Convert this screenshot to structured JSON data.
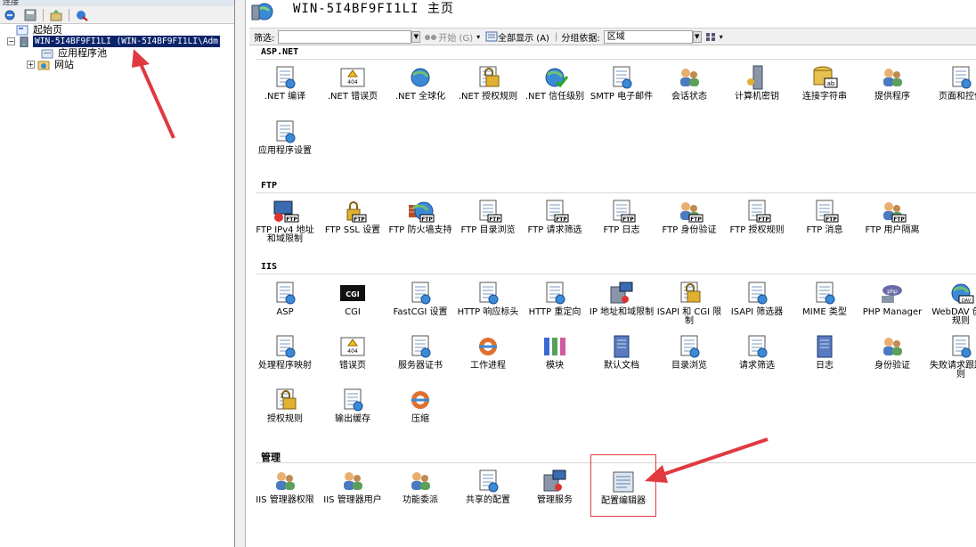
{
  "left_panel": {
    "header": "连接",
    "tree": [
      {
        "label": "起始页",
        "icon": "start-page-icon"
      },
      {
        "label": "WIN-5I4BF9FI1LI (WIN-5I4BF9FI1LI\\Adm",
        "icon": "server-icon",
        "selected": true
      },
      {
        "label": "应用程序池",
        "icon": "app-pool-icon"
      },
      {
        "label": "网站",
        "icon": "sites-icon"
      }
    ]
  },
  "header": {
    "title": "WIN-5I4BF9FI1LI 主页"
  },
  "filterbar": {
    "filter_label": "筛选:",
    "go_label": "开始 (G)",
    "showall_label": "全部显示 (A)",
    "groupby_label": "分组依据:",
    "groupby_value": "区域"
  },
  "sections": [
    {
      "title": "ASP.NET",
      "items": [
        {
          "label": ".NET 编译",
          "icon": "net-compile-icon"
        },
        {
          "label": ".NET 错误页",
          "icon": "error-404-icon"
        },
        {
          "label": ".NET 全球化",
          "icon": "globe-icon"
        },
        {
          "label": ".NET 授权规则",
          "icon": "lock-doc-icon"
        },
        {
          "label": ".NET 信任级别",
          "icon": "trust-globe-icon"
        },
        {
          "label": "SMTP 电子邮件",
          "icon": "smtp-icon"
        },
        {
          "label": "会话状态",
          "icon": "session-icon"
        },
        {
          "label": "计算机密钥",
          "icon": "machine-key-icon"
        },
        {
          "label": "连接字符串",
          "icon": "db-ab-icon"
        },
        {
          "label": "提供程序",
          "icon": "provider-icon"
        },
        {
          "label": "页面和控件",
          "icon": "pages-icon"
        },
        {
          "label": "应用程序设置",
          "icon": "app-settings-icon"
        }
      ]
    },
    {
      "title": "FTP",
      "items": [
        {
          "label": "FTP IPv4 地址和域限制",
          "icon": "ftp-ip-icon"
        },
        {
          "label": "FTP SSL 设置",
          "icon": "ftp-ssl-icon"
        },
        {
          "label": "FTP 防火墙支持",
          "icon": "ftp-firewall-icon"
        },
        {
          "label": "FTP 目录浏览",
          "icon": "ftp-browse-icon"
        },
        {
          "label": "FTP 请求筛选",
          "icon": "ftp-filter-icon"
        },
        {
          "label": "FTP 日志",
          "icon": "ftp-log-icon"
        },
        {
          "label": "FTP 身份验证",
          "icon": "ftp-auth-icon"
        },
        {
          "label": "FTP 授权规则",
          "icon": "ftp-authz-icon"
        },
        {
          "label": "FTP 消息",
          "icon": "ftp-msg-icon"
        },
        {
          "label": "FTP 用户隔离",
          "icon": "ftp-isolation-icon"
        }
      ]
    },
    {
      "title": "IIS",
      "items": [
        {
          "label": "ASP",
          "icon": "asp-icon"
        },
        {
          "label": "CGI",
          "icon": "cgi-icon"
        },
        {
          "label": "FastCGI 设置",
          "icon": "fastcgi-icon"
        },
        {
          "label": "HTTP 响应标头",
          "icon": "http-headers-icon"
        },
        {
          "label": "HTTP 重定向",
          "icon": "redirect-icon"
        },
        {
          "label": "IP 地址和域限制",
          "icon": "ip-restrict-icon"
        },
        {
          "label": "ISAPI 和 CGI 限制",
          "icon": "isapi-cgi-icon"
        },
        {
          "label": "ISAPI 筛选器",
          "icon": "isapi-filter-icon"
        },
        {
          "label": "MIME 类型",
          "icon": "mime-icon"
        },
        {
          "label": "PHP Manager",
          "icon": "php-icon"
        },
        {
          "label": "WebDAV 创作规则",
          "icon": "webdav-icon"
        },
        {
          "label": "处理程序映射",
          "icon": "handler-icon"
        },
        {
          "label": "错误页",
          "icon": "error-404-icon"
        },
        {
          "label": "服务器证书",
          "icon": "cert-icon"
        },
        {
          "label": "工作进程",
          "icon": "worker-icon"
        },
        {
          "label": "模块",
          "icon": "modules-icon"
        },
        {
          "label": "默认文档",
          "icon": "default-doc-icon"
        },
        {
          "label": "目录浏览",
          "icon": "dir-browse-icon"
        },
        {
          "label": "请求筛选",
          "icon": "req-filter-icon"
        },
        {
          "label": "日志",
          "icon": "log-icon"
        },
        {
          "label": "身份验证",
          "icon": "auth-icon"
        },
        {
          "label": "失败请求跟踪规则",
          "icon": "failed-req-icon"
        },
        {
          "label": "授权规则",
          "icon": "authz-icon"
        },
        {
          "label": "输出缓存",
          "icon": "output-cache-icon"
        },
        {
          "label": "压缩",
          "icon": "compress-icon"
        }
      ]
    },
    {
      "title": "管理",
      "items": [
        {
          "label": "IIS 管理器权限",
          "icon": "mgr-perm-icon"
        },
        {
          "label": "IIS 管理器用户",
          "icon": "mgr-users-icon"
        },
        {
          "label": "功能委派",
          "icon": "delegation-icon"
        },
        {
          "label": "共享的配置",
          "icon": "shared-config-icon"
        },
        {
          "label": "管理服务",
          "icon": "mgmt-service-icon"
        },
        {
          "label": "配置编辑器",
          "icon": "config-editor-icon",
          "highlighted": true
        }
      ]
    }
  ],
  "colors": {
    "arrow": "#e0393e",
    "selection": "#0a246a"
  }
}
